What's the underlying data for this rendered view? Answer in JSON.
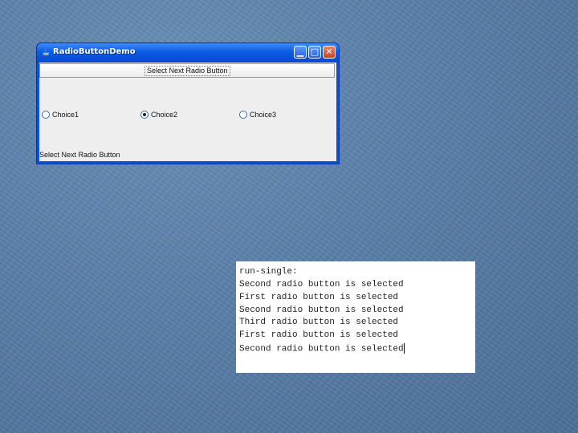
{
  "window": {
    "title": "RadioButtonDemo",
    "top_button_label": "Select Next Radio Button",
    "radios": [
      {
        "label": "Choice1",
        "checked": false
      },
      {
        "label": "Choice2",
        "checked": true
      },
      {
        "label": "Choice3",
        "checked": false
      }
    ],
    "status_text": "Select Next Radio Button"
  },
  "console": {
    "lines": [
      "run-single:",
      "Second radio button is selected",
      "First radio button is selected",
      "Second radio button is selected",
      "Third radio button is selected",
      "First radio button is selected",
      "Second radio button is selected"
    ]
  },
  "colors": {
    "desktop": "#5a7fa9",
    "titlebar": "#0c5be5",
    "client": "#eeeeee"
  }
}
